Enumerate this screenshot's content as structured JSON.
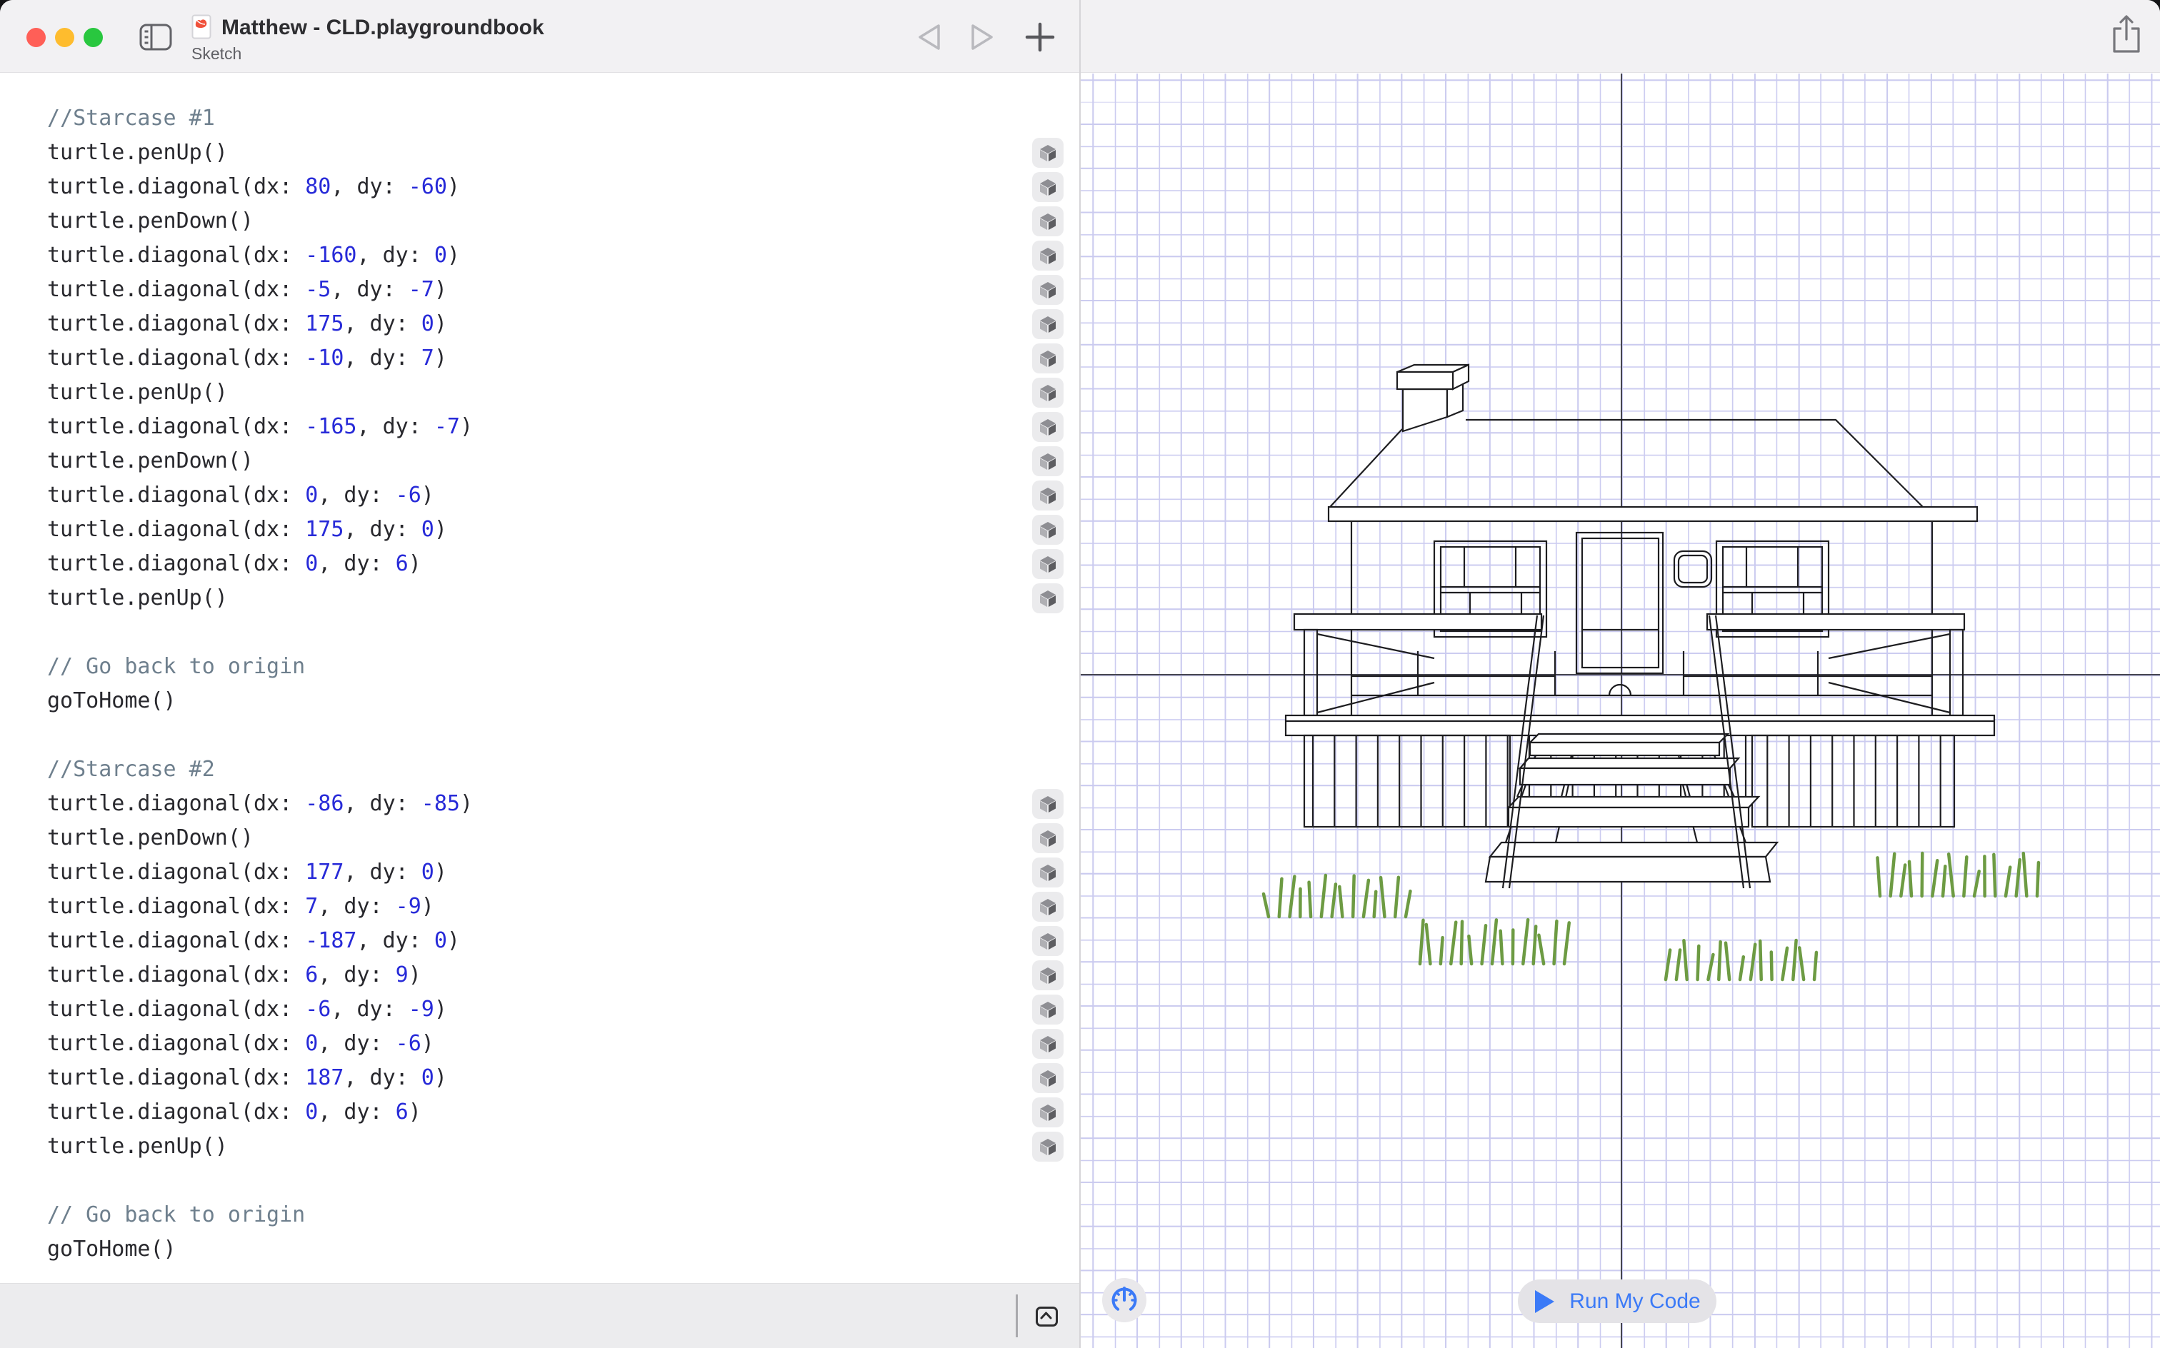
{
  "window": {
    "title": "Matthew - CLD.playgroundbook",
    "subtitle": "Sketch"
  },
  "canvas": {
    "run_button_label": "Run My Code"
  },
  "icons": {
    "traffic": [
      "close-icon",
      "minimize-icon",
      "zoom-icon"
    ],
    "sidebar_toggle": "sidebar-toggle-icon",
    "file": "swift-file-icon",
    "back": "back-chevron-icon",
    "forward": "forward-chevron-icon",
    "new_tab": "plus-icon",
    "share": "share-icon",
    "line_marker": "cube-icon",
    "speed": "speedometer-icon",
    "run": "play-icon",
    "collapse": "chevron-up-box-icon"
  },
  "colors": {
    "accent_blue": "#3b7af7",
    "number_literal": "#272ad8",
    "comment": "#6e7f8d",
    "grid_line": "#cbcbf0",
    "grass": "#6d9b43"
  },
  "code": {
    "lines": [
      {
        "s": [
          [
            "//Starcase #1",
            "cmt"
          ]
        ]
      },
      {
        "m": 1,
        "s": [
          [
            "turtle.penUp()",
            "code"
          ]
        ]
      },
      {
        "m": 1,
        "s": [
          [
            "turtle.diagonal(dx: ",
            "code"
          ],
          [
            "80",
            "num"
          ],
          [
            ", dy: ",
            "code"
          ],
          [
            "-60",
            "num"
          ],
          [
            ")",
            "code"
          ]
        ]
      },
      {
        "m": 1,
        "s": [
          [
            "turtle.penDown()",
            "code"
          ]
        ]
      },
      {
        "m": 1,
        "s": [
          [
            "turtle.diagonal(dx: ",
            "code"
          ],
          [
            "-160",
            "num"
          ],
          [
            ", dy: ",
            "code"
          ],
          [
            "0",
            "num"
          ],
          [
            ")",
            "code"
          ]
        ]
      },
      {
        "m": 1,
        "s": [
          [
            "turtle.diagonal(dx: ",
            "code"
          ],
          [
            "-5",
            "num"
          ],
          [
            ", dy: ",
            "code"
          ],
          [
            "-7",
            "num"
          ],
          [
            ")",
            "code"
          ]
        ]
      },
      {
        "m": 1,
        "s": [
          [
            "turtle.diagonal(dx: ",
            "code"
          ],
          [
            "175",
            "num"
          ],
          [
            ", dy: ",
            "code"
          ],
          [
            "0",
            "num"
          ],
          [
            ")",
            "code"
          ]
        ]
      },
      {
        "m": 1,
        "s": [
          [
            "turtle.diagonal(dx: ",
            "code"
          ],
          [
            "-10",
            "num"
          ],
          [
            ", dy: ",
            "code"
          ],
          [
            "7",
            "num"
          ],
          [
            ")",
            "code"
          ]
        ]
      },
      {
        "m": 1,
        "s": [
          [
            "turtle.penUp()",
            "code"
          ]
        ]
      },
      {
        "m": 1,
        "s": [
          [
            "turtle.diagonal(dx: ",
            "code"
          ],
          [
            "-165",
            "num"
          ],
          [
            ", dy: ",
            "code"
          ],
          [
            "-7",
            "num"
          ],
          [
            ")",
            "code"
          ]
        ]
      },
      {
        "m": 1,
        "s": [
          [
            "turtle.penDown()",
            "code"
          ]
        ]
      },
      {
        "m": 1,
        "s": [
          [
            "turtle.diagonal(dx: ",
            "code"
          ],
          [
            "0",
            "num"
          ],
          [
            ", dy: ",
            "code"
          ],
          [
            "-6",
            "num"
          ],
          [
            ")",
            "code"
          ]
        ]
      },
      {
        "m": 1,
        "s": [
          [
            "turtle.diagonal(dx: ",
            "code"
          ],
          [
            "175",
            "num"
          ],
          [
            ", dy: ",
            "code"
          ],
          [
            "0",
            "num"
          ],
          [
            ")",
            "code"
          ]
        ]
      },
      {
        "m": 1,
        "s": [
          [
            "turtle.diagonal(dx: ",
            "code"
          ],
          [
            "0",
            "num"
          ],
          [
            ", dy: ",
            "code"
          ],
          [
            "6",
            "num"
          ],
          [
            ")",
            "code"
          ]
        ]
      },
      {
        "m": 1,
        "s": [
          [
            "turtle.penUp()",
            "code"
          ]
        ]
      },
      {
        "b": 1
      },
      {
        "s": [
          [
            "// Go back to origin",
            "cmt"
          ]
        ]
      },
      {
        "s": [
          [
            "goToHome()",
            "code"
          ]
        ]
      },
      {
        "b": 1
      },
      {
        "s": [
          [
            "//Starcase #2",
            "cmt"
          ]
        ]
      },
      {
        "m": 1,
        "s": [
          [
            "turtle.diagonal(dx: ",
            "code"
          ],
          [
            "-86",
            "num"
          ],
          [
            ", dy: ",
            "code"
          ],
          [
            "-85",
            "num"
          ],
          [
            ")",
            "code"
          ]
        ]
      },
      {
        "m": 1,
        "s": [
          [
            "turtle.penDown()",
            "code"
          ]
        ]
      },
      {
        "m": 1,
        "s": [
          [
            "turtle.diagonal(dx: ",
            "code"
          ],
          [
            "177",
            "num"
          ],
          [
            ", dy: ",
            "code"
          ],
          [
            "0",
            "num"
          ],
          [
            ")",
            "code"
          ]
        ]
      },
      {
        "m": 1,
        "s": [
          [
            "turtle.diagonal(dx: ",
            "code"
          ],
          [
            "7",
            "num"
          ],
          [
            ", dy: ",
            "code"
          ],
          [
            "-9",
            "num"
          ],
          [
            ")",
            "code"
          ]
        ]
      },
      {
        "m": 1,
        "s": [
          [
            "turtle.diagonal(dx: ",
            "code"
          ],
          [
            "-187",
            "num"
          ],
          [
            ", dy: ",
            "code"
          ],
          [
            "0",
            "num"
          ],
          [
            ")",
            "code"
          ]
        ]
      },
      {
        "m": 1,
        "s": [
          [
            "turtle.diagonal(dx: ",
            "code"
          ],
          [
            "6",
            "num"
          ],
          [
            ", dy: ",
            "code"
          ],
          [
            "9",
            "num"
          ],
          [
            ")",
            "code"
          ]
        ]
      },
      {
        "m": 1,
        "s": [
          [
            "turtle.diagonal(dx: ",
            "code"
          ],
          [
            "-6",
            "num"
          ],
          [
            ", dy: ",
            "code"
          ],
          [
            "-9",
            "num"
          ],
          [
            ")",
            "code"
          ]
        ]
      },
      {
        "m": 1,
        "s": [
          [
            "turtle.diagonal(dx: ",
            "code"
          ],
          [
            "0",
            "num"
          ],
          [
            ", dy: ",
            "code"
          ],
          [
            "-6",
            "num"
          ],
          [
            ")",
            "code"
          ]
        ]
      },
      {
        "m": 1,
        "s": [
          [
            "turtle.diagonal(dx: ",
            "code"
          ],
          [
            "187",
            "num"
          ],
          [
            ", dy: ",
            "code"
          ],
          [
            "0",
            "num"
          ],
          [
            ")",
            "code"
          ]
        ]
      },
      {
        "m": 1,
        "s": [
          [
            "turtle.diagonal(dx: ",
            "code"
          ],
          [
            "0",
            "num"
          ],
          [
            ", dy: ",
            "code"
          ],
          [
            "6",
            "num"
          ],
          [
            ")",
            "code"
          ]
        ]
      },
      {
        "m": 1,
        "s": [
          [
            "turtle.penUp()",
            "code"
          ]
        ]
      },
      {
        "b": 1
      },
      {
        "s": [
          [
            "// Go back to origin",
            "cmt"
          ]
        ]
      },
      {
        "s": [
          [
            "goToHome()",
            "code"
          ]
        ]
      }
    ]
  }
}
